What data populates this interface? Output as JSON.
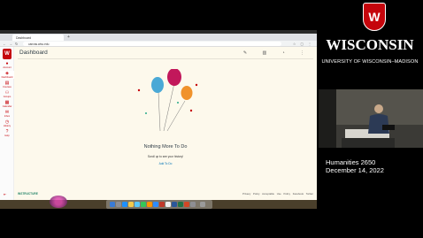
{
  "browser": {
    "tab_title": "Dashboard",
    "new_tab": "+",
    "url": "canvas.wisc.edu"
  },
  "canvas": {
    "logo_letter": "W",
    "nav": [
      {
        "label": "Account",
        "icon": "user-icon"
      },
      {
        "label": "Dashboard",
        "icon": "dashboard-icon"
      },
      {
        "label": "Courses",
        "icon": "book-icon"
      },
      {
        "label": "Groups",
        "icon": "groups-icon"
      },
      {
        "label": "Calendar",
        "icon": "calendar-icon"
      },
      {
        "label": "Inbox",
        "icon": "inbox-icon"
      },
      {
        "label": "History",
        "icon": "clock-icon"
      },
      {
        "label": "Help",
        "icon": "help-icon"
      }
    ],
    "page_title": "Dashboard",
    "empty_title": "Nothing More To Do",
    "empty_sub": "Scroll up to see your history!",
    "empty_link": "Add To Do",
    "footer_logo": "INSTRUCTURE",
    "footer_links": "Privacy Policy   Acceptable Use Policy   Facebook   Twitter"
  },
  "lecture": {
    "university": "WISCONSIN",
    "subtitle": "UNIVERSITY OF WISCONSIN–MADISON",
    "crest_letter": "W",
    "course": "Humanities 2650",
    "date": "December 14, 2022"
  },
  "colors": {
    "brand_red": "#c5050c",
    "link_blue": "#0374b5",
    "canvas_bg": "#fdf9ec"
  }
}
